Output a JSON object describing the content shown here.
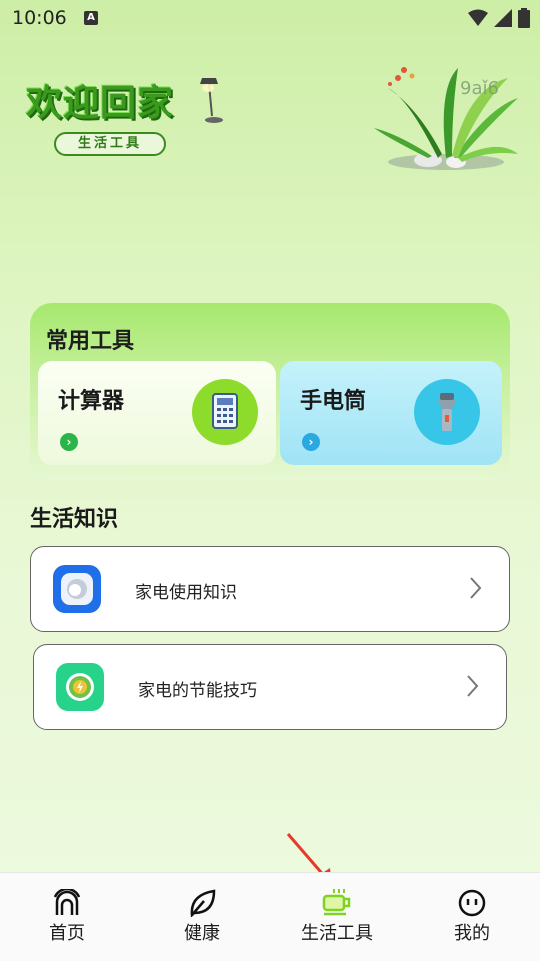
{
  "status": {
    "time": "10:06",
    "indicator": "A"
  },
  "hero": {
    "title": "欢迎回家",
    "tag": "生活工具",
    "number": "9aǐ6"
  },
  "tools": {
    "title": "常用工具",
    "items": [
      {
        "label": "计算器",
        "icon": "calculator-icon",
        "arrow": "›"
      },
      {
        "label": "手电筒",
        "icon": "flashlight-icon",
        "arrow": "›"
      }
    ]
  },
  "knowledge": {
    "title": "生活知识",
    "items": [
      {
        "label": "家电使用知识",
        "icon": "appliance-icon"
      },
      {
        "label": "家电的节能技巧",
        "icon": "energy-saving-icon"
      }
    ]
  },
  "nav": [
    {
      "label": "首页",
      "icon": "home-icon"
    },
    {
      "label": "健康",
      "icon": "leaf-icon"
    },
    {
      "label": "生活工具",
      "icon": "cup-icon",
      "active": true
    },
    {
      "label": "我的",
      "icon": "profile-icon"
    }
  ],
  "colors": {
    "accent": "#7ed321",
    "tool_green": "#8ddb2a",
    "tool_cyan": "#38c6e8",
    "arrow_red": "#e53a2a"
  }
}
